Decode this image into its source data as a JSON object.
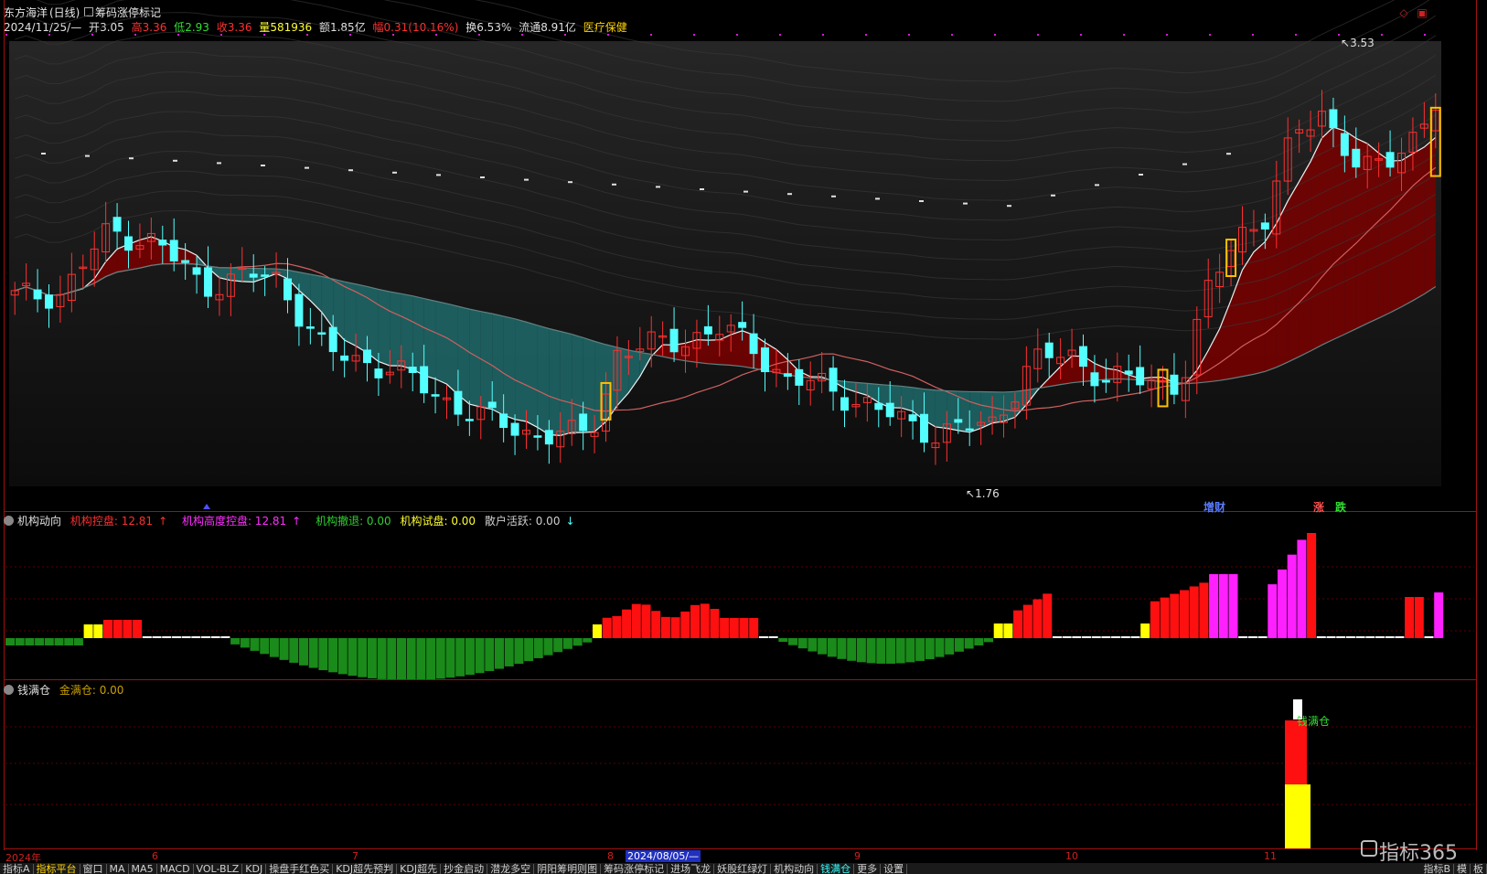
{
  "title": {
    "stock": "东方海洋",
    "period": "(日线)",
    "indicator": "筹码涨停标记"
  },
  "info": {
    "date": "2024/11/25/—",
    "open_label": "开",
    "open": "3.05",
    "high_label": "高",
    "high": "3.36",
    "low_label": "低",
    "low": "2.93",
    "close_label": "收",
    "close": "3.36",
    "volume_label": "量",
    "volume": "581936",
    "amount_label": "额",
    "amount": "1.85亿",
    "change_label": "幅",
    "change": "0.31(10.16%)",
    "turnover_label": "换",
    "turnover": "6.53%",
    "float_label": "流通",
    "float": "8.91亿",
    "sector": "医疗保健"
  },
  "main_chart": {
    "high_marker": "3.53",
    "low_marker": "1.76",
    "tags": [
      "增财",
      "涨",
      "跌"
    ]
  },
  "pane2": {
    "name": "机构动向",
    "items": [
      {
        "label": "机构控盘: 12.81",
        "arrow": "↑",
        "color": "#ff3030"
      },
      {
        "label": "机构高度控盘: 12.81",
        "arrow": "↑",
        "color": "#ff30ff"
      },
      {
        "label": "机构撤退: 0.00",
        "arrow": "",
        "color": "#30d030"
      },
      {
        "label": "机构试盘: 0.00",
        "arrow": "",
        "color": "#ffff30"
      },
      {
        "label": "散户活跃: 0.00",
        "arrow": "↓",
        "color": "#d0d0d0"
      }
    ]
  },
  "pane3": {
    "name": "钱满仓",
    "item": "金满仓: 0.00",
    "bar_label": "钱满仓"
  },
  "time_axis": [
    "2024年",
    "6",
    "7",
    "8",
    "2024/08/05/—",
    "9",
    "10",
    "11"
  ],
  "tabs": [
    "指标A",
    "指标平台",
    "窗口",
    "MA",
    "MA5",
    "MACD",
    "VOL-BLZ",
    "KDJ",
    "操盘手红色买",
    "KDJ超先预判",
    "KDJ超先",
    "抄金启动",
    "潜龙多空",
    "阴阳筹明则图",
    "筹码涨停标记",
    "进场飞龙",
    "妖股红绿灯",
    "机构动向",
    "钱满仓",
    "更多",
    "设置"
  ],
  "right_tabs": [
    "指标B",
    "模",
    "板"
  ],
  "brand": "指标365",
  "colors": {
    "up": "#ff3030",
    "down": "#54ffff",
    "bull_band": "#7a0000",
    "bear_band": "#1e6a6a",
    "border": "#a01010"
  },
  "chart_data": [
    {
      "type": "candlestick",
      "title": "",
      "x_labels": [
        "2024年",
        "6",
        "7",
        "8",
        "9",
        "10",
        "11"
      ],
      "y_markers": {
        "high": 3.53,
        "low": 1.76
      },
      "last": {
        "open": 3.05,
        "high": 3.36,
        "low": 2.93,
        "close": 3.36
      },
      "bands": [
        "cyan bearish band Jun–Aug",
        "red bullish band Aug, Oct–Nov"
      ]
    },
    {
      "type": "bar",
      "title": "机构动向",
      "series": [
        {
          "name": "机构控盘",
          "value": 12.81
        },
        {
          "name": "机构高度控盘",
          "value": 12.81
        },
        {
          "name": "机构撤退",
          "value": 0.0
        },
        {
          "name": "机构试盘",
          "value": 0.0
        },
        {
          "name": "散户活跃",
          "value": 0.0
        }
      ]
    },
    {
      "type": "bar",
      "title": "钱满仓",
      "series": [
        {
          "name": "金满仓",
          "value": 0.0
        }
      ]
    }
  ]
}
